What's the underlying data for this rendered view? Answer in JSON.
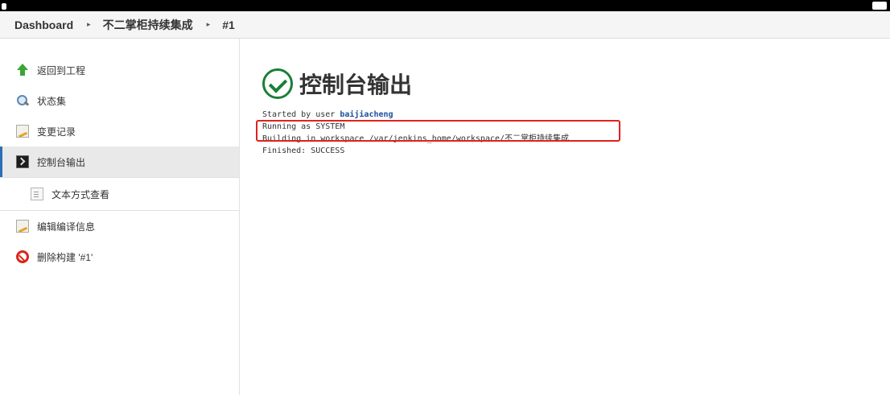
{
  "breadcrumb": {
    "items": [
      "Dashboard",
      "不二掌柜持续集成",
      "#1"
    ],
    "separator": "▸"
  },
  "sidebar": {
    "items": [
      {
        "label": "返回到工程",
        "icon": "up-arrow-icon"
      },
      {
        "label": "状态集",
        "icon": "search-icon"
      },
      {
        "label": "变更记录",
        "icon": "notepad-icon"
      },
      {
        "label": "控制台输出",
        "icon": "console-icon",
        "active": true
      },
      {
        "label": "文本方式查看",
        "icon": "document-icon",
        "sub": true
      },
      {
        "label": "编辑编译信息",
        "icon": "notepad-icon"
      },
      {
        "label": "删除构建 '#1'",
        "icon": "delete-ban-icon"
      }
    ]
  },
  "main": {
    "title": "控制台输出",
    "status_icon": "success-check-icon",
    "console": {
      "started_prefix": "Started by user ",
      "user": "baijiacheng",
      "running": "Running as SYSTEM",
      "building": "Building in workspace /var/jenkins_home/workspace/不二掌柜持续集成",
      "finished": "Finished: SUCCESS"
    }
  },
  "colors": {
    "active_border": "#2c6fb6",
    "success": "#1a7f37",
    "highlight": "#e0211e",
    "user_link": "#1b4f9c"
  }
}
